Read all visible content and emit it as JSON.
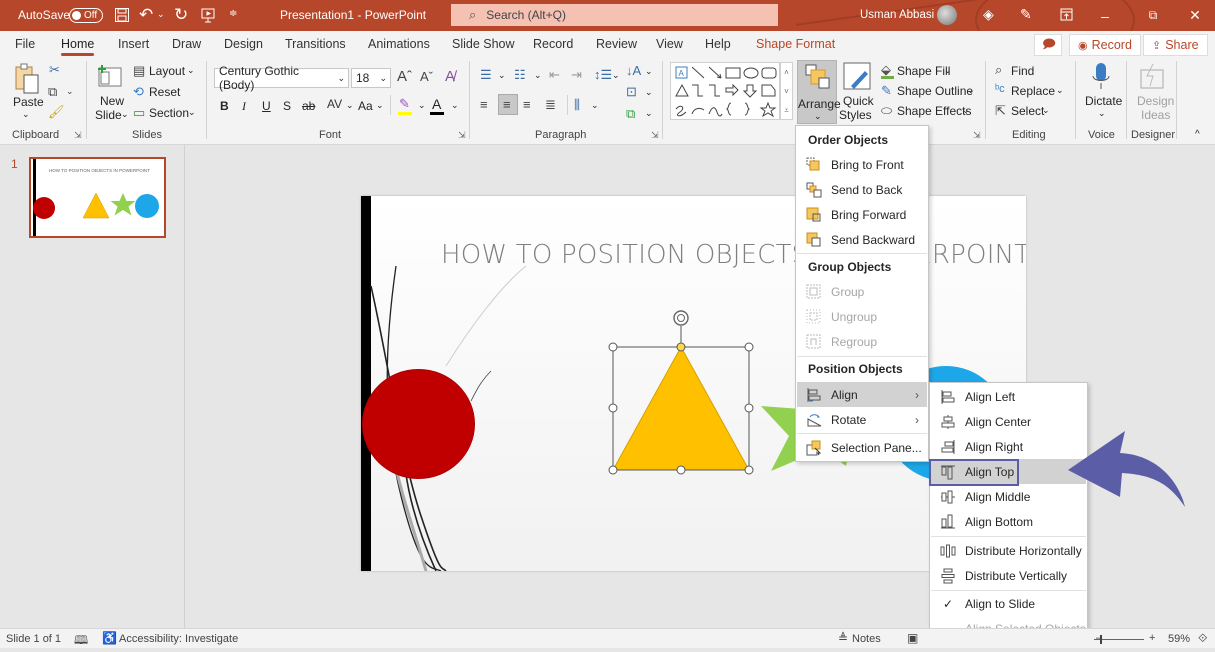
{
  "titlebar": {
    "autosave_label": "AutoSave",
    "autosave_state": "Off",
    "doc_title": "Presentation1  -  PowerPoint",
    "search_placeholder": "Search (Alt+Q)",
    "user_name": "Usman Abbasi",
    "minimize": "–",
    "restore": "⧉",
    "close": "✕"
  },
  "tabs": [
    {
      "label": "File"
    },
    {
      "label": "Home",
      "active": true
    },
    {
      "label": "Insert"
    },
    {
      "label": "Draw"
    },
    {
      "label": "Design"
    },
    {
      "label": "Transitions"
    },
    {
      "label": "Animations"
    },
    {
      "label": "Slide Show"
    },
    {
      "label": "Record"
    },
    {
      "label": "Review"
    },
    {
      "label": "View"
    },
    {
      "label": "Help"
    },
    {
      "label": "Shape Format",
      "accent": true
    }
  ],
  "tab_actions": {
    "record": "Record",
    "share": "Share"
  },
  "ribbon": {
    "clipboard": {
      "paste": "Paste",
      "label": "Clipboard"
    },
    "slides": {
      "new_slide_1": "New",
      "new_slide_2": "Slide",
      "layout": "Layout",
      "reset": "Reset",
      "section": "Section",
      "label": "Slides"
    },
    "font": {
      "font_name": "Century Gothic (Body)",
      "font_size": "18",
      "bold": "B",
      "italic": "I",
      "underline": "U",
      "shadow": "S",
      "strike": "ab",
      "spacing": "AV",
      "case": "Aa",
      "label": "Font"
    },
    "paragraph": {
      "label": "Paragraph"
    },
    "drawing": {
      "arrange_label": "Arrange",
      "quick_styles_1": "Quick",
      "quick_styles_2": "Styles",
      "shape_fill": "Shape Fill",
      "shape_outline": "Shape Outline",
      "shape_effects": "Shape Effects"
    },
    "editing": {
      "find": "Find",
      "replace": "Replace",
      "select": "Select",
      "label": "Editing"
    },
    "voice": {
      "dictate": "Dictate",
      "label": "Voice"
    },
    "designer": {
      "design_ideas_1": "Design",
      "design_ideas_2": "Ideas",
      "label": "Designer"
    }
  },
  "thumbnails": [
    {
      "number": "1",
      "title": "HOW TO POSITION OBJECTS  IN POWERPOINT"
    }
  ],
  "slide": {
    "title": "HOW TO POSITION OBJECTS  IN POWERPOINT",
    "colors": {
      "circle_red": "#c00000",
      "triangle": "#ffc000",
      "star": "#92d050",
      "circle_blue": "#1ea7e8"
    }
  },
  "arrange_menu": {
    "order_header": "Order Objects",
    "order_items": [
      {
        "label": "Bring to Front",
        "icon": "bring-to-front-icon"
      },
      {
        "label": "Send to Back",
        "icon": "send-to-back-icon"
      },
      {
        "label": "Bring Forward",
        "icon": "bring-forward-icon"
      },
      {
        "label": "Send Backward",
        "icon": "send-backward-icon"
      }
    ],
    "group_header": "Group Objects",
    "group_items": [
      {
        "label": "Group",
        "disabled": true
      },
      {
        "label": "Ungroup",
        "disabled": true
      },
      {
        "label": "Regroup",
        "disabled": true
      }
    ],
    "position_header": "Position Objects",
    "position_items": [
      {
        "label": "Align",
        "submenu": true,
        "highlighted": true
      },
      {
        "label": "Rotate",
        "submenu": true
      },
      {
        "label": "Selection Pane..."
      }
    ]
  },
  "align_menu": {
    "items": [
      {
        "label": "Align Left"
      },
      {
        "label": "Align Center"
      },
      {
        "label": "Align Right"
      },
      {
        "label": "Align Top",
        "highlighted": true
      },
      {
        "label": "Align Middle"
      },
      {
        "label": "Align Bottom"
      },
      {
        "label": "Distribute Horizontally"
      },
      {
        "label": "Distribute Vertically"
      },
      {
        "label": "Align to Slide",
        "checked": true
      },
      {
        "label": "Align Selected Objects",
        "disabled": true
      }
    ],
    "check_glyph": "✓"
  },
  "annotation": {
    "arrow_color": "#5b5ea6",
    "highlight_color": "#5b5ea6"
  },
  "status": {
    "slide_info": "Slide 1 of 1",
    "accessibility": "Accessibility: Investigate",
    "notes": "Notes",
    "zoom": "59%",
    "zoom_minus": "–",
    "zoom_plus": "+"
  }
}
